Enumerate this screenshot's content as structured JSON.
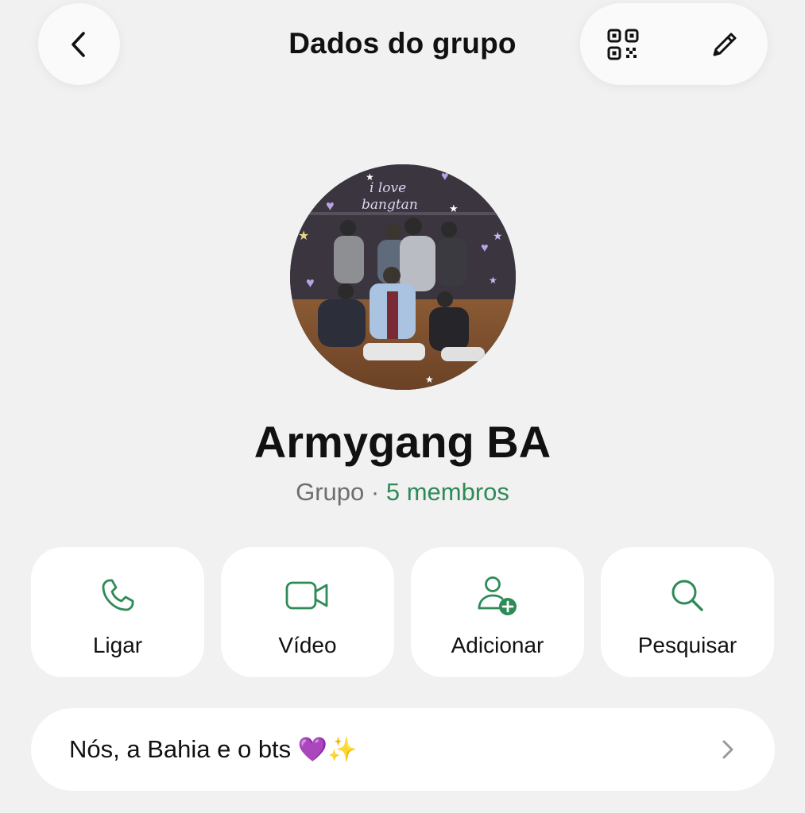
{
  "header": {
    "title": "Dados do grupo",
    "back_icon": "chevron-left-icon",
    "qr_icon": "qr-code-icon",
    "edit_icon": "pencil-icon"
  },
  "profile": {
    "avatar_text_line1": "i love",
    "avatar_text_line2": "bangtan",
    "name": "Armygang BA",
    "type": "Grupo",
    "separator": "·",
    "members": "5 membros"
  },
  "actions": [
    {
      "label": "Ligar",
      "icon": "phone-icon"
    },
    {
      "label": "Vídeo",
      "icon": "video-camera-icon"
    },
    {
      "label": "Adicionar",
      "icon": "add-user-icon"
    },
    {
      "label": "Pesquisar",
      "icon": "search-icon"
    }
  ],
  "description": {
    "text": "Nós, a Bahia e o bts",
    "emoji1": "💜",
    "emoji2": "✨"
  },
  "colors": {
    "accent": "#2e8b57",
    "background": "#f1f1f1",
    "card": "#ffffff"
  }
}
